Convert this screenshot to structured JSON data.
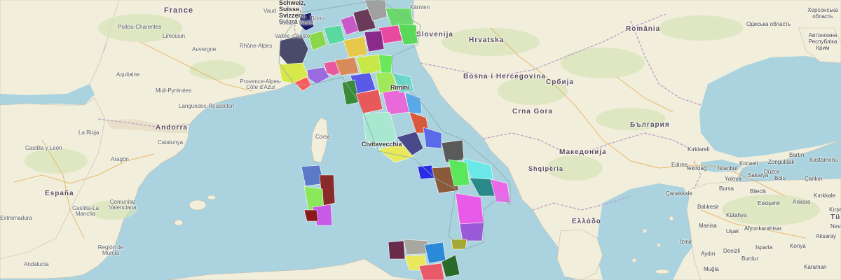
{
  "labels": {
    "france": "France",
    "switzerland": "Schweiz, Suisse, Svizzera, Svizra",
    "vaud": "Vaud",
    "ticino": "Ticino",
    "valais": "Valais - Wallis",
    "vallee_aoste": "Vallée d'Aoste",
    "karnten": "Kärnten",
    "slovenija": "Slovenija",
    "hrvatska": "Hrvatska",
    "romania": "România",
    "odessa": "Одеська область",
    "kherson": "Херсонська область",
    "crimea": "Автономна Республіка Крим",
    "poitou": "Poitou-Charentes",
    "limousin": "Limousin",
    "rhone_alpes": "Rhône-Alpes",
    "auvergne": "Auvergne",
    "aquitaine": "Aquitaine",
    "midi_pyrenees": "Midi-Pyrénées",
    "paca": "Provence-Alpes-Côte d'Azur",
    "languedoc": "Languedoc-Roussillon",
    "andorra": "Andorra",
    "la_rioja": "La Rioja",
    "catalunya": "Catalunya",
    "castilla_leon": "Castilla y León",
    "aragon": "Aragón",
    "espana": "España",
    "extremadura": "Extremadura",
    "castilla_mancha": "Castilla-La Mancha",
    "valenciana": "Comunitat Valenciana",
    "murcia": "Región de Murcia",
    "andalucia": "Andalucía",
    "corse": "Corse",
    "civitavecchia": "Civitavecchia",
    "rimini": "Rimini",
    "bosna": "Bosna i Hercegovina",
    "srbija": "Србија",
    "crna_gora": "Crna Gora",
    "bulgaria": "България",
    "makedonija": "Македонија",
    "shqiperia": "Shqipëria",
    "ellada": "Ελλάδα",
    "kirklareli": "Kırklareli",
    "edirne": "Edirne",
    "tekirdag": "Tekirdağ",
    "istanbul": "İstanbul",
    "kocaeli": "Kocaeli",
    "sakarya": "Sakarya",
    "duzce": "Düzce",
    "bolu": "Bolu",
    "bartin": "Bartın",
    "kastamonu": "Kastamonu",
    "zonguldak": "Zonguldak",
    "cankiri": "Çankırı",
    "yalova": "Yalova",
    "bursa": "Bursa",
    "bilecik": "Bilecik",
    "eskisehir": "Eskişehir",
    "canakkale": "Çanakkale",
    "balikesir": "Balıkesir",
    "kutahya": "Kütahya",
    "ankara": "Ankara",
    "kirikkale": "Kırıkkale",
    "manisa": "Manisa",
    "usak": "Uşak",
    "afyon": "Afyonkarahisar",
    "izmir": "İzmir",
    "aydin": "Aydın",
    "denizli": "Denizli",
    "isparta": "Isparta",
    "konya": "Konya",
    "aksaray": "Aksaray",
    "mugla": "Muğla",
    "burdur": "Burdur",
    "karaman": "Karaman",
    "turkiye": "Tü",
    "kirsehir": "Kırşe",
    "nevsehir": "Nevş"
  },
  "colors": {
    "sea": "#aad3df",
    "land": "#f0ecd8",
    "forest": "#cfe0b4",
    "border": "#b7a0c4",
    "road": "#e8a84a"
  },
  "italy_provinces": [
    {
      "name": "valle-aosta",
      "color": "#1a1a6e"
    },
    {
      "name": "torino",
      "color": "#4a4a6a"
    },
    {
      "name": "cuneo",
      "color": "#d8e84a"
    },
    {
      "name": "imperia",
      "color": "#ff5a5a"
    },
    {
      "name": "savona",
      "color": "#9a6ae0"
    },
    {
      "name": "genova",
      "color": "#e85aa0"
    },
    {
      "name": "novara",
      "color": "#8ad84a"
    },
    {
      "name": "milano",
      "color": "#5ad8a0"
    },
    {
      "name": "bergamo",
      "color": "#c85ac8"
    },
    {
      "name": "brescia",
      "color": "#6a3a5a"
    },
    {
      "name": "trento",
      "color": "#a0a0a0"
    },
    {
      "name": "bolzano",
      "color": "#6ad86a"
    },
    {
      "name": "belluno",
      "color": "#e84aa0"
    },
    {
      "name": "udine",
      "color": "#5ad85a"
    },
    {
      "name": "venezia",
      "color": "#8a2a8a"
    },
    {
      "name": "verona",
      "color": "#e8c84a"
    },
    {
      "name": "parma",
      "color": "#d88a5a"
    },
    {
      "name": "bologna",
      "color": "#c8e84a"
    },
    {
      "name": "ravenna",
      "color": "#6ae85a"
    },
    {
      "name": "firenze",
      "color": "#5a5ae8"
    },
    {
      "name": "pisa",
      "color": "#3a8a3a"
    },
    {
      "name": "siena",
      "color": "#e85a5a"
    },
    {
      "name": "arezzo",
      "color": "#a0e85a"
    },
    {
      "name": "perugia",
      "color": "#e86ad8"
    },
    {
      "name": "ancona",
      "color": "#6ad8c8"
    },
    {
      "name": "macerata",
      "color": "#5aa8e8"
    },
    {
      "name": "roma",
      "color": "#a8e8d0"
    },
    {
      "name": "latina",
      "color": "#e8e85a"
    },
    {
      "name": "frosinone",
      "color": "#4a4a8a"
    },
    {
      "name": "pescara",
      "color": "#d85a3a"
    },
    {
      "name": "chieti",
      "color": "#5a6ae8"
    },
    {
      "name": "foggia",
      "color": "#5a5a5a"
    },
    {
      "name": "bari",
      "color": "#6ae8e8"
    },
    {
      "name": "napoli",
      "color": "#2a2ae8"
    },
    {
      "name": "salerno",
      "color": "#8a5a3a"
    },
    {
      "name": "potenza",
      "color": "#5ae85a"
    },
    {
      "name": "taranto",
      "color": "#2a8a8a"
    },
    {
      "name": "lecce",
      "color": "#e86ae8"
    },
    {
      "name": "cosenza",
      "color": "#e85ae8"
    },
    {
      "name": "catanzaro",
      "color": "#9a5ad8"
    },
    {
      "name": "reggio-calabria",
      "color": "#a8a82a"
    },
    {
      "name": "trapani",
      "color": "#6a2a4a"
    },
    {
      "name": "palermo",
      "color": "#a8a8a0"
    },
    {
      "name": "agrigento",
      "color": "#e8e85a"
    },
    {
      "name": "caltanissetta",
      "color": "#2a8ad8"
    },
    {
      "name": "catania",
      "color": "#e85a6a"
    },
    {
      "name": "siracusa",
      "color": "#2a6a2a"
    },
    {
      "name": "sassari",
      "color": "#5a7ac8"
    },
    {
      "name": "nuoro",
      "color": "#8a2a2a"
    },
    {
      "name": "oristano",
      "color": "#8ae85a"
    },
    {
      "name": "cagliari",
      "color": "#c85ae8"
    },
    {
      "name": "carbonia",
      "color": "#8a1a1a"
    }
  ]
}
